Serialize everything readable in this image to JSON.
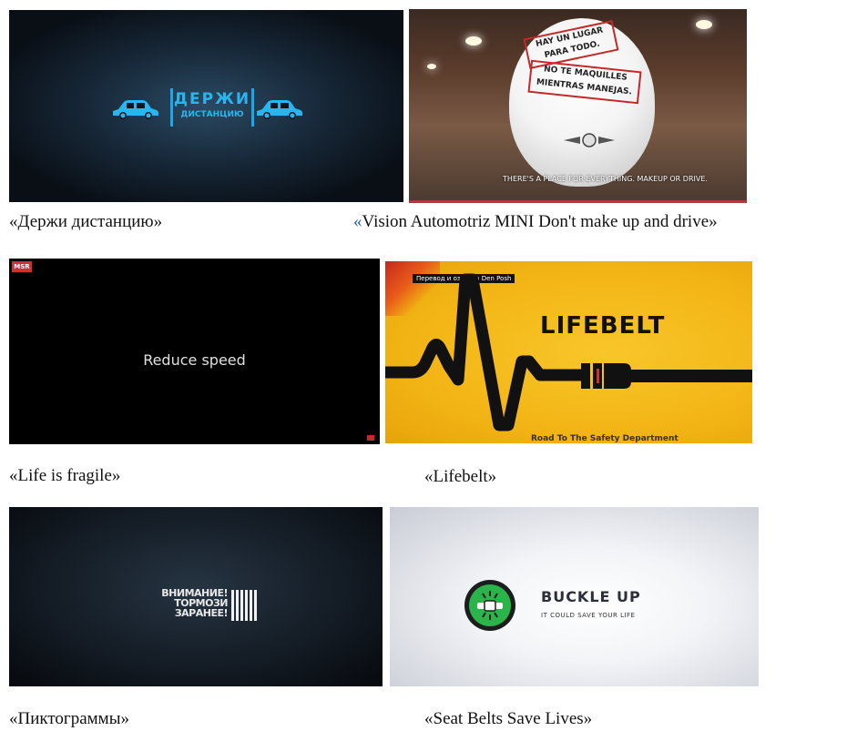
{
  "tiles": [
    {
      "caption_text": "«Держи дистанцию»",
      "brand_line1": "ДЕРЖИ",
      "brand_line2": "ДИСТАНЦИЮ",
      "accent": "#29b6f0"
    },
    {
      "caption_prefix": "«",
      "caption_rest": "Vision Automotriz MINI Don't make up and drive»",
      "sign1": "HAY UN LUGAR PARA TODO.",
      "sign2": "NO TE MAQUILLES MIENTRAS MANEJAS.",
      "subtitle": "THERE'S A PLACE FOR EVERYTHING. MAKEUP OR DRIVE."
    },
    {
      "caption_text": "«Life is fragile»",
      "logo": "MSR",
      "text": "Reduce speed"
    },
    {
      "caption_text": "«Lifebelt»",
      "credit": "Перевод и озвучка  Den Posh",
      "title": "LIFEBELT",
      "bottom_text": "Road To The Safety Department"
    },
    {
      "caption_text": "«Пиктограммы»",
      "line1": "ВНИМАНИЕ!",
      "line2": "ТОРМОЗИ",
      "line3": "ЗАРАНЕЕ!"
    },
    {
      "caption_text": "«Seat Belts Save Lives»",
      "title": "BUCKLE UP",
      "tagline": "IT COULD SAVE YOUR LIFE"
    }
  ]
}
